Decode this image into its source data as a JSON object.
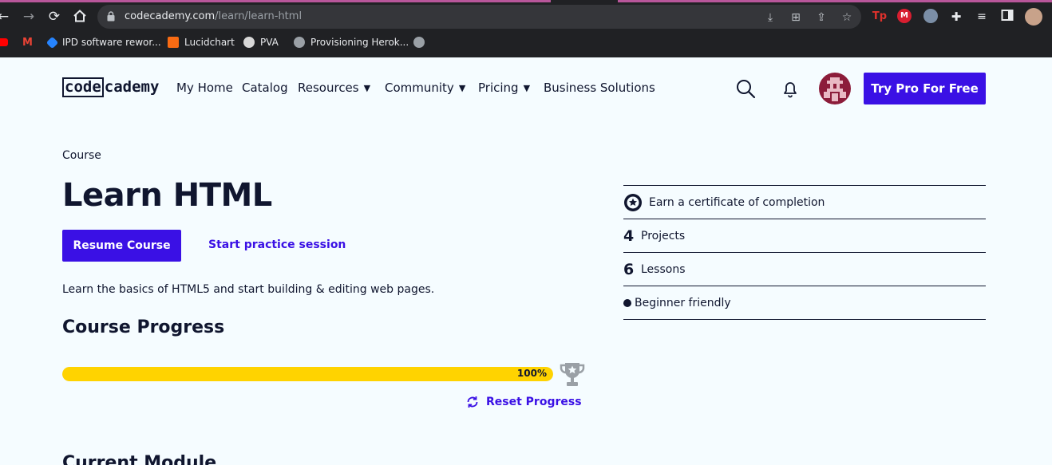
{
  "browser": {
    "url_host": "codecademy.com",
    "url_path": "/learn/learn-html",
    "bookmarks": [
      {
        "label": "IPD software rewor..."
      },
      {
        "label": "Lucidchart"
      },
      {
        "label": "PVA"
      },
      {
        "label": "Provisioning Herok..."
      }
    ],
    "extensions": [
      {
        "label": "Tp",
        "color": "#e0312c"
      },
      {
        "label": "M",
        "color": "#d81e30"
      }
    ]
  },
  "header": {
    "logo": {
      "boxed": "code",
      "rest": "cademy"
    },
    "nav": [
      {
        "label": "My Home",
        "dropdown": false
      },
      {
        "label": "Catalog",
        "dropdown": false
      },
      {
        "label": "Resources",
        "dropdown": true
      },
      {
        "label": "Community",
        "dropdown": true
      },
      {
        "label": "Pricing",
        "dropdown": true
      },
      {
        "label": "Business Solutions",
        "dropdown": false
      }
    ],
    "caret": "▼",
    "try_pro": "Try Pro For Free"
  },
  "course": {
    "eyebrow": "Course",
    "title": "Learn HTML",
    "resume": "Resume Course",
    "practice": "Start practice session",
    "description": "Learn the basics of HTML5 and start building & editing web pages.",
    "progress_heading": "Course Progress",
    "progress_percent": 100,
    "progress_label": "100%",
    "reset": "Reset Progress",
    "next_section": "Current Module"
  },
  "facts": {
    "certificate": "Earn a certificate of completion",
    "projects_count": "4",
    "projects_label": "Projects",
    "lessons_count": "6",
    "lessons_label": "Lessons",
    "level": "Beginner friendly"
  },
  "colors": {
    "accent": "#3a10e5",
    "progress": "#ffd300",
    "text": "#10162f",
    "background": "#f5fcff"
  }
}
